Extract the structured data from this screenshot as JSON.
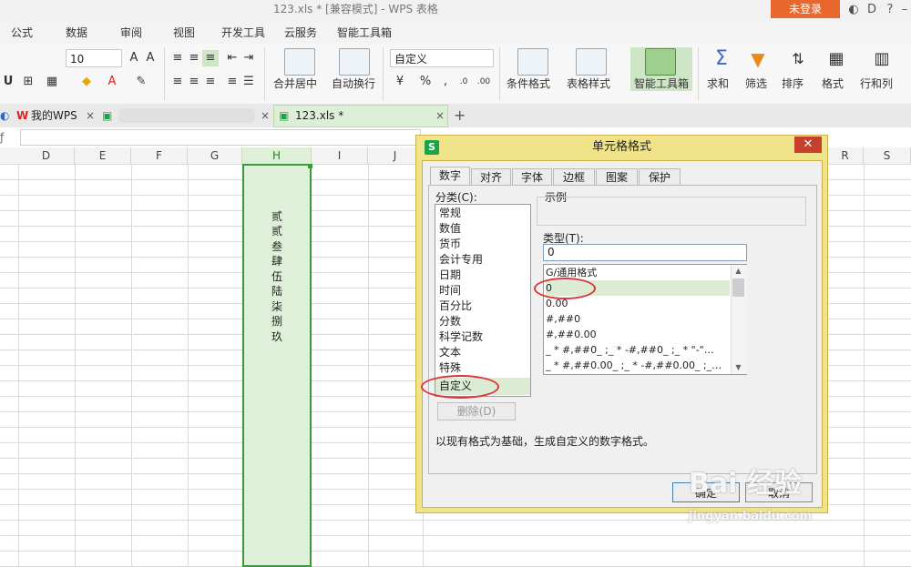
{
  "window": {
    "title": "123.xls * [兼容模式] - WPS 表格",
    "login_label": "未登录"
  },
  "menu": [
    "公式",
    "数据",
    "审阅",
    "视图",
    "开发工具",
    "云服务",
    "智能工具箱"
  ],
  "ribbon": {
    "font_size": "10",
    "number_format": "自定义",
    "merge_center": "合并居中",
    "wrap_text": "自动换行",
    "conditional_format": "条件格式",
    "table_style": "表格样式",
    "smart_toolbox": "智能工具箱",
    "sum": "求和",
    "filter": "筛选",
    "sort": "排序",
    "format": "格式",
    "row_col": "行和列"
  },
  "tabs": {
    "wps_home": "我的WPS",
    "file_tab": "123.xls *"
  },
  "columns": [
    "D",
    "E",
    "F",
    "G",
    "H",
    "I",
    "J",
    "R",
    "S"
  ],
  "cells_H": [
    "贰",
    "贰",
    "叁",
    "肆",
    "伍",
    "陆",
    "柒",
    "捌",
    "玖"
  ],
  "dialog": {
    "title": "单元格格式",
    "tabs": [
      "数字",
      "对齐",
      "字体",
      "边框",
      "图案",
      "保护"
    ],
    "category_label": "分类(C):",
    "categories": [
      "常规",
      "数值",
      "货币",
      "会计专用",
      "日期",
      "时间",
      "百分比",
      "分数",
      "科学记数",
      "文本",
      "特殊",
      "自定义"
    ],
    "sample_label": "示例",
    "type_label": "类型(T):",
    "type_value": "0",
    "formats": [
      "G/通用格式",
      "0",
      "0.00",
      "#,##0",
      "#,##0.00",
      "_ * #,##0_ ;_ * -#,##0_ ;_ * \"-\"…",
      "_ * #,##0.00_ ;_ * -#,##0.00_ ;_…"
    ],
    "delete_label": "删除(D)",
    "hint": "以现有格式为基础，生成自定义的数字格式。",
    "ok_label": "确定",
    "cancel_label": "取消"
  },
  "watermark": {
    "line1": "Bai 经验",
    "line2": "jingyan.baidu.com"
  },
  "colors": {
    "accent_green": "#3a9a3a",
    "dialog_frame": "#f1e38a",
    "close_red": "#c7402e",
    "login_orange": "#e8672c"
  }
}
